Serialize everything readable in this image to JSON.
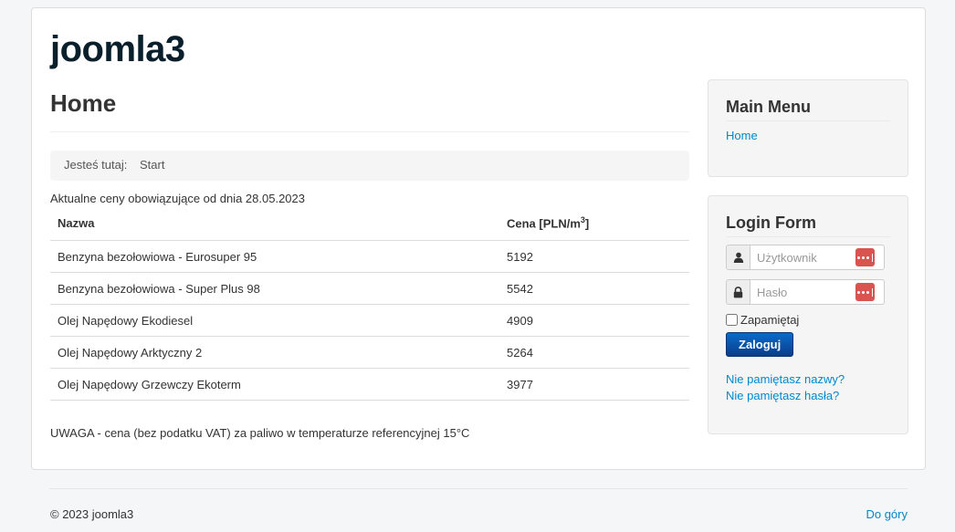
{
  "site": {
    "brand": "joomla3"
  },
  "main": {
    "page_title": "Home",
    "breadcrumb": {
      "label": "Jesteś tutaj:",
      "current": "Start"
    },
    "intro": "Aktualne ceny obowiązujące od dnia 28.05.2023",
    "table": {
      "headers": [
        "Nazwa",
        "Cena [PLN/m",
        "3",
        "]"
      ],
      "rows": [
        {
          "name": "Benzyna bezołowiowa - Eurosuper 95",
          "price": "5192"
        },
        {
          "name": "Benzyna bezołowiowa - Super Plus 98",
          "price": "5542"
        },
        {
          "name": "Olej Napędowy Ekodiesel",
          "price": "4909"
        },
        {
          "name": "Olej Napędowy Arktyczny 2",
          "price": "5264"
        },
        {
          "name": "Olej Napędowy Grzewczy Ekoterm",
          "price": "3977"
        }
      ]
    },
    "note": "UWAGA - cena (bez podatku VAT) za paliwo w temperaturze referencyjnej 15°C"
  },
  "sidebar": {
    "main_menu": {
      "title": "Main Menu",
      "items": [
        "Home"
      ]
    },
    "login": {
      "title": "Login Form",
      "username_placeholder": "Użytkownik",
      "password_placeholder": "Hasło",
      "remember_label": "Zapamiętaj",
      "submit_label": "Zaloguj",
      "forgot_username": "Nie pamiętasz nazwy?",
      "forgot_password": "Nie pamiętasz hasła?"
    }
  },
  "footer": {
    "copyright": "© 2023 joomla3",
    "back_to_top": "Do góry"
  },
  "colors": {
    "link": "#0088cc",
    "button": "#0a4a9e",
    "badge": "#d9534f"
  },
  "icons": {
    "user": "user-icon",
    "lock": "lock-icon",
    "password_manager": "password-manager-icon"
  }
}
